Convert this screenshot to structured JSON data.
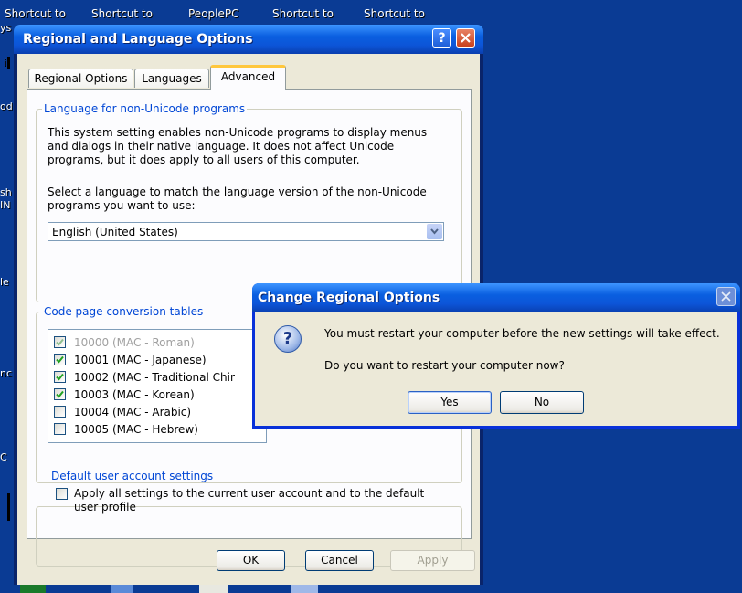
{
  "desktop": {
    "shortcuts": [
      "Shortcut to",
      "Shortcut to",
      "PeoplePC",
      "Shortcut to",
      "Shortcut to"
    ],
    "edge_fragments": [
      "ys",
      "i",
      "od",
      "sh",
      "IN",
      "le",
      "nc",
      "C"
    ]
  },
  "window": {
    "title": "Regional and Language Options",
    "help_label": "?",
    "tabs": [
      "Regional Options",
      "Languages",
      "Advanced"
    ],
    "nonunicode": {
      "legend": "Language for non-Unicode programs",
      "description": [
        "This system setting enables non-Unicode programs to display menus",
        "and dialogs in their native language. It does not affect Unicode",
        "programs, but it does apply to all users of this computer."
      ],
      "select_prompt": [
        "Select a language to match the language version of the non-Unicode",
        "programs you want to use:"
      ],
      "selected_language": "English (United States)"
    },
    "codepages": {
      "legend": "Code page conversion tables",
      "items": [
        {
          "label": "10000 (MAC - Roman)",
          "checked": true,
          "disabled": true
        },
        {
          "label": "10001 (MAC - Japanese)",
          "checked": true,
          "disabled": false
        },
        {
          "label": "10002 (MAC - Traditional Chir",
          "checked": true,
          "disabled": false
        },
        {
          "label": "10003 (MAC - Korean)",
          "checked": true,
          "disabled": false
        },
        {
          "label": "10004 (MAC - Arabic)",
          "checked": false,
          "disabled": false
        },
        {
          "label": "10005 (MAC - Hebrew)",
          "checked": false,
          "disabled": false
        }
      ]
    },
    "default_user": {
      "legend": "Default user account settings",
      "checkbox_label": [
        "Apply all settings to the current user account and to the default",
        "user profile"
      ],
      "checked": false
    },
    "buttons": {
      "ok": "OK",
      "cancel": "Cancel",
      "apply": "Apply"
    }
  },
  "dialog": {
    "title": "Change Regional Options",
    "message": "You must restart your computer before the new settings will take effect.",
    "question": "Do you want to restart your computer now?",
    "yes_label": "Yes",
    "no_label": "No",
    "icon_glyph": "?"
  },
  "colors": {
    "desktop": "#0a3b94",
    "titlebar": "#0a5fe0",
    "legend_text": "#0046d5",
    "client_bg": "#ece9d8",
    "close_red": "#c7401d",
    "tab_highlight": "#ffc73c"
  },
  "icons": [
    "help-icon",
    "close-icon",
    "chevron-down-icon",
    "checkmark-icon",
    "question-icon"
  ]
}
